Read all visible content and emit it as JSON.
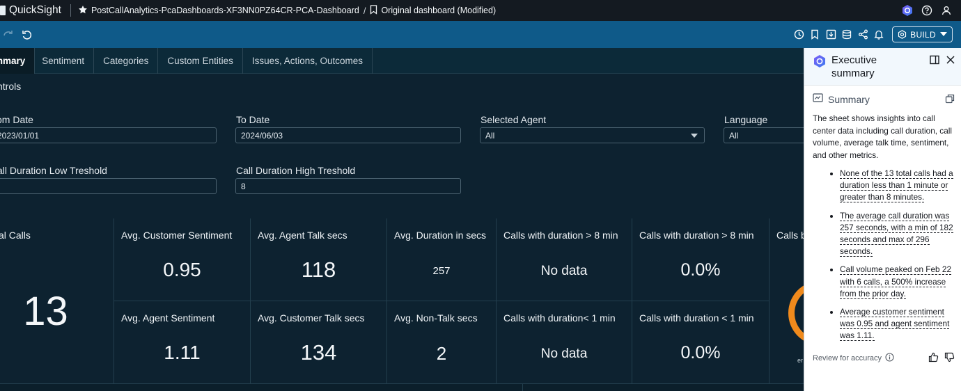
{
  "topbar": {
    "brand": "QuickSight",
    "dashboard_path": "PostCallAnalytics-PcaDashboards-XF3NN0PZ64CR-PCA-Dashboard",
    "path_separator": "/",
    "sheet_name": "Original dashboard (Modified)"
  },
  "toolbar": {
    "build_label": "BUILD"
  },
  "tabs": [
    {
      "label": "mmary"
    },
    {
      "label": "Sentiment"
    },
    {
      "label": "Categories"
    },
    {
      "label": "Custom Entities"
    },
    {
      "label": "Issues, Actions, Outcomes"
    }
  ],
  "controls": {
    "section_label": "ntrols",
    "from_date": {
      "label": "om Date",
      "value": "2023/01/01"
    },
    "to_date": {
      "label": "To Date",
      "value": "2024/06/03"
    },
    "selected_agent": {
      "label": "Selected Agent",
      "value": "All"
    },
    "language": {
      "label": "Language",
      "value": "All"
    },
    "low_threshold": {
      "label": "all Duration Low Treshold",
      "value": ""
    },
    "high_threshold": {
      "label": "Call Duration High Treshold",
      "value": "8"
    }
  },
  "kpis": {
    "total_calls": {
      "title": "al Calls",
      "value": "13"
    },
    "avg_customer_sentiment": {
      "title": "Avg. Customer Sentiment",
      "value": "0.95"
    },
    "avg_agent_talk": {
      "title": "Avg. Agent Talk secs",
      "value": "118"
    },
    "avg_duration": {
      "title": "Avg. Duration in secs",
      "value": "257"
    },
    "calls_gt8_count": {
      "title": "Calls with duration > 8 min",
      "value": "No data"
    },
    "calls_gt8_pct": {
      "title": "Calls with duration > 8 min",
      "value": "0.0%"
    },
    "calls_by": {
      "title": "Calls b"
    },
    "avg_agent_sentiment": {
      "title": "Avg. Agent Sentiment",
      "value": "1.11"
    },
    "avg_customer_talk": {
      "title": "Avg. Customer Talk secs",
      "value": "134"
    },
    "avg_nontalk": {
      "title": "Avg. Non-Talk secs",
      "value": "2"
    },
    "calls_lt1_count": {
      "title": "Calls with duration< 1 min",
      "value": "No data"
    },
    "calls_lt1_pct": {
      "title": "Calls with duration < 1 min",
      "value": "0.0%"
    },
    "gauge_label": "er"
  },
  "exec_summary": {
    "title": "Executive summary",
    "section": "Summary",
    "intro": "The sheet shows insights into call center data including call duration, call volume, average talk time, sentiment, and other metrics.",
    "bullets": [
      "None of the 13 total calls had a duration less than 1 minute or greater than 8 minutes.",
      "The average call duration was 257 seconds, with a min of 182 seconds and max of 296 seconds.",
      "Call volume peaked on Feb 22 with 6 calls, a 500% increase from the prior day.",
      "Average customer sentiment was 0.95 and agent sentiment was 1.11."
    ],
    "review": "Review for accuracy"
  },
  "icons": {
    "header_left": [
      "star-icon",
      "bookmark-icon"
    ],
    "header_right": [
      "q-assistant-icon",
      "help-icon",
      "user-icon"
    ],
    "toolbar_left": [
      "redo-icon",
      "undo-icon"
    ],
    "toolbar_right": [
      "schedule-icon",
      "bookmark-icon",
      "download-icon",
      "dataset-icon",
      "share-icon",
      "alert-icon"
    ]
  },
  "colors": {
    "topbar": "#141a21",
    "toolbar": "#0f5a89",
    "canvas": "#0d2230",
    "gauge": "#f08a1c",
    "panel": "#ffffff"
  }
}
